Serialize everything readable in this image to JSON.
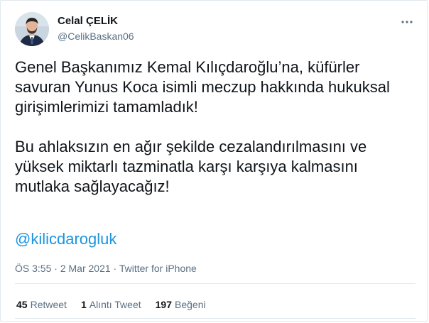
{
  "user": {
    "name": "Celal ÇELİK",
    "handle": "@CelikBaskan06"
  },
  "tweet": {
    "paragraph_1": "Genel Başkanımız Kemal Kılıçdaroğlu’na, küfürler\nsavuran Yunus Koca isimli meczup hakkında hukuksal\ngirişimlerimizi tamamladık!",
    "paragraph_2": "Bu ahlaksızın en ağır şekilde cezalandırılmasını ve\nyüksek miktarlı tazminatla karşı karşıya kalmasını\nmutlaka sağlayacağız!",
    "mention": "@kilicdarogluk"
  },
  "meta": {
    "time": "ÖS 3:55",
    "separator_1": " · ",
    "date": "2 Mar 2021",
    "separator_2": " · ",
    "source": "Twitter for iPhone"
  },
  "stats": {
    "retweet_count": "45",
    "retweet_label": "Retweet",
    "quote_count": "1",
    "quote_label": "Alıntı Tweet",
    "like_count": "197",
    "like_label": "Beğeni"
  },
  "icons": {
    "more": "more-horizontal-icon"
  },
  "colors": {
    "link": "#1b95e0",
    "secondary_text": "#5b7083",
    "primary_text": "#0f1419",
    "border": "#e1e8ed"
  }
}
